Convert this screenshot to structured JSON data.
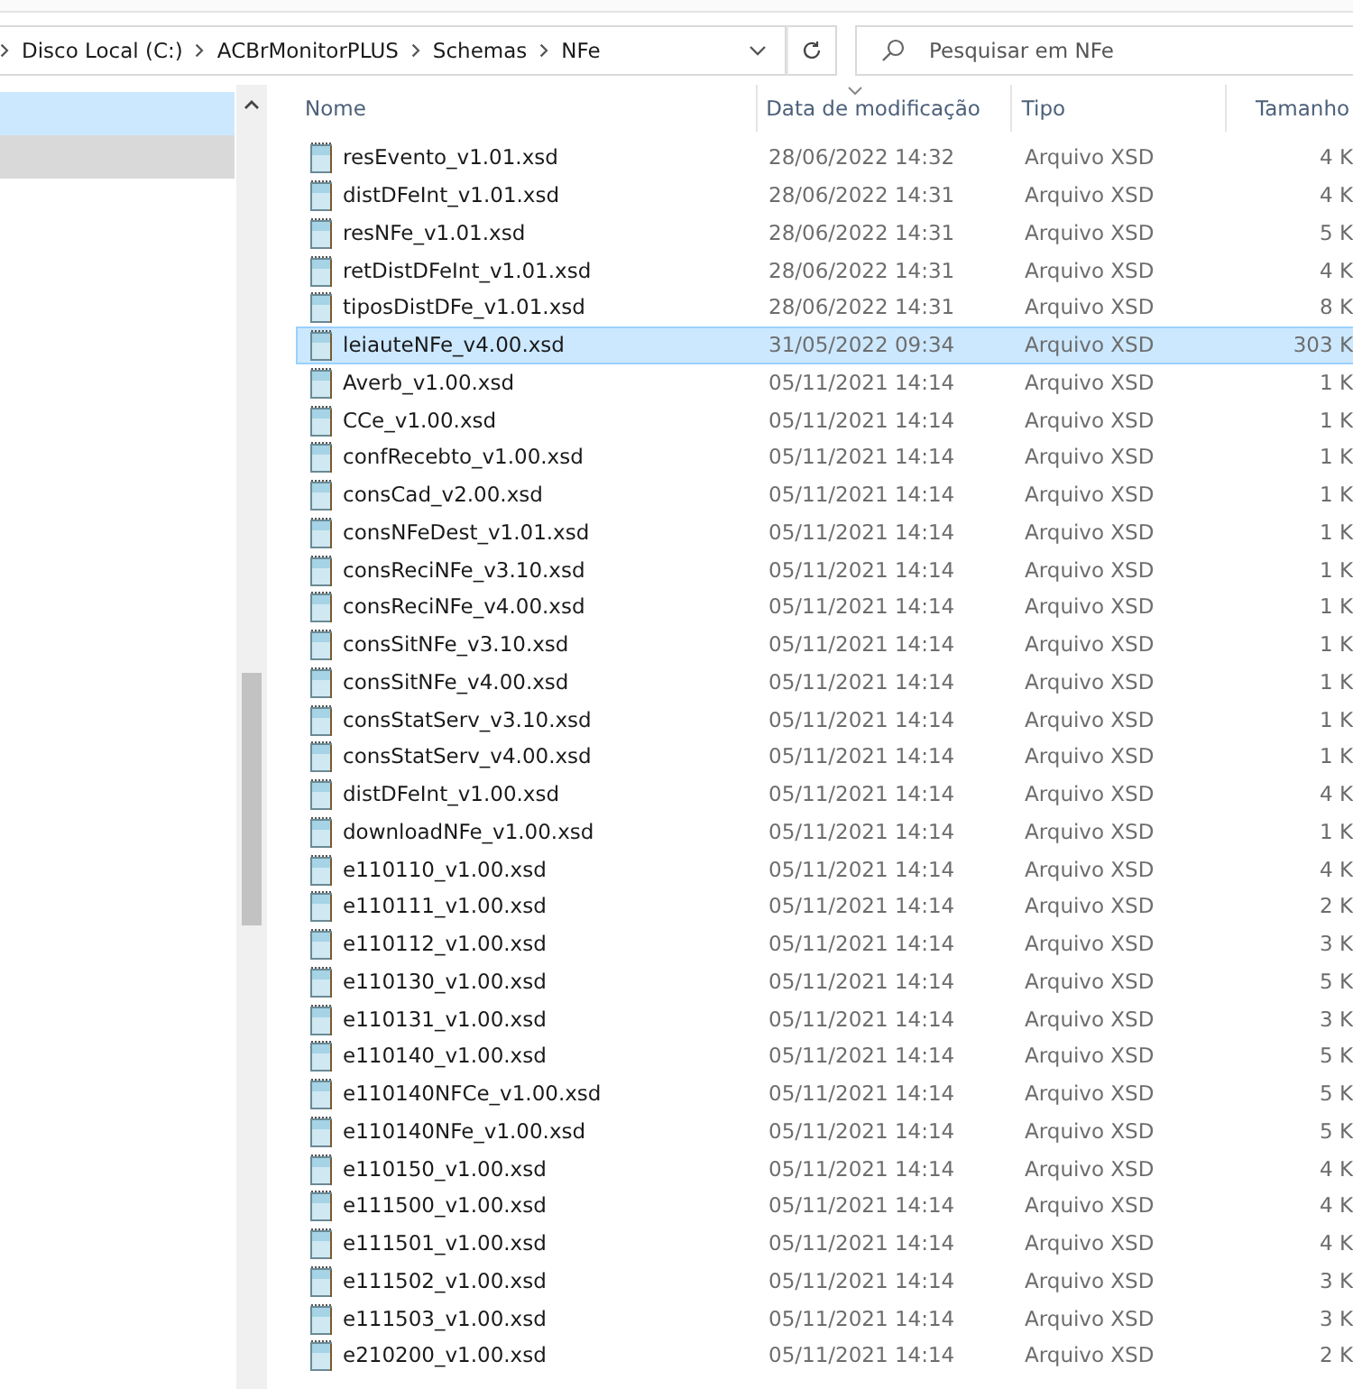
{
  "address_bar": {
    "breadcrumbs": [
      "Disco Local (C:)",
      "ACBrMonitorPLUS",
      "Schemas",
      "NFe"
    ]
  },
  "search": {
    "placeholder": "Pesquisar em NFe"
  },
  "navigation_pane": {
    "items": [
      {
        "selected": true
      },
      {
        "selected": false
      }
    ]
  },
  "file_list": {
    "columns": [
      "Nome",
      "Data de modificação",
      "Tipo",
      "Tamanho"
    ],
    "rows": [
      {
        "name": "resEvento_v1.01.xsd",
        "date": "28/06/2022 14:32",
        "type": "Arquivo XSD",
        "size": "4 K",
        "selected": false
      },
      {
        "name": "distDFeInt_v1.01.xsd",
        "date": "28/06/2022 14:31",
        "type": "Arquivo XSD",
        "size": "4 K",
        "selected": false
      },
      {
        "name": "resNFe_v1.01.xsd",
        "date": "28/06/2022 14:31",
        "type": "Arquivo XSD",
        "size": "5 K",
        "selected": false
      },
      {
        "name": "retDistDFeInt_v1.01.xsd",
        "date": "28/06/2022 14:31",
        "type": "Arquivo XSD",
        "size": "4 K",
        "selected": false
      },
      {
        "name": "tiposDistDFe_v1.01.xsd",
        "date": "28/06/2022 14:31",
        "type": "Arquivo XSD",
        "size": "8 K",
        "selected": false
      },
      {
        "name": "leiauteNFe_v4.00.xsd",
        "date": "31/05/2022 09:34",
        "type": "Arquivo XSD",
        "size": "303 K",
        "selected": true
      },
      {
        "name": "Averb_v1.00.xsd",
        "date": "05/11/2021 14:14",
        "type": "Arquivo XSD",
        "size": "1 K",
        "selected": false
      },
      {
        "name": "CCe_v1.00.xsd",
        "date": "05/11/2021 14:14",
        "type": "Arquivo XSD",
        "size": "1 K",
        "selected": false
      },
      {
        "name": "confRecebto_v1.00.xsd",
        "date": "05/11/2021 14:14",
        "type": "Arquivo XSD",
        "size": "1 K",
        "selected": false
      },
      {
        "name": "consCad_v2.00.xsd",
        "date": "05/11/2021 14:14",
        "type": "Arquivo XSD",
        "size": "1 K",
        "selected": false
      },
      {
        "name": "consNFeDest_v1.01.xsd",
        "date": "05/11/2021 14:14",
        "type": "Arquivo XSD",
        "size": "1 K",
        "selected": false
      },
      {
        "name": "consReciNFe_v3.10.xsd",
        "date": "05/11/2021 14:14",
        "type": "Arquivo XSD",
        "size": "1 K",
        "selected": false
      },
      {
        "name": "consReciNFe_v4.00.xsd",
        "date": "05/11/2021 14:14",
        "type": "Arquivo XSD",
        "size": "1 K",
        "selected": false
      },
      {
        "name": "consSitNFe_v3.10.xsd",
        "date": "05/11/2021 14:14",
        "type": "Arquivo XSD",
        "size": "1 K",
        "selected": false
      },
      {
        "name": "consSitNFe_v4.00.xsd",
        "date": "05/11/2021 14:14",
        "type": "Arquivo XSD",
        "size": "1 K",
        "selected": false
      },
      {
        "name": "consStatServ_v3.10.xsd",
        "date": "05/11/2021 14:14",
        "type": "Arquivo XSD",
        "size": "1 K",
        "selected": false
      },
      {
        "name": "consStatServ_v4.00.xsd",
        "date": "05/11/2021 14:14",
        "type": "Arquivo XSD",
        "size": "1 K",
        "selected": false
      },
      {
        "name": "distDFeInt_v1.00.xsd",
        "date": "05/11/2021 14:14",
        "type": "Arquivo XSD",
        "size": "4 K",
        "selected": false
      },
      {
        "name": "downloadNFe_v1.00.xsd",
        "date": "05/11/2021 14:14",
        "type": "Arquivo XSD",
        "size": "1 K",
        "selected": false
      },
      {
        "name": "e110110_v1.00.xsd",
        "date": "05/11/2021 14:14",
        "type": "Arquivo XSD",
        "size": "4 K",
        "selected": false
      },
      {
        "name": "e110111_v1.00.xsd",
        "date": "05/11/2021 14:14",
        "type": "Arquivo XSD",
        "size": "2 K",
        "selected": false
      },
      {
        "name": "e110112_v1.00.xsd",
        "date": "05/11/2021 14:14",
        "type": "Arquivo XSD",
        "size": "3 K",
        "selected": false
      },
      {
        "name": "e110130_v1.00.xsd",
        "date": "05/11/2021 14:14",
        "type": "Arquivo XSD",
        "size": "5 K",
        "selected": false
      },
      {
        "name": "e110131_v1.00.xsd",
        "date": "05/11/2021 14:14",
        "type": "Arquivo XSD",
        "size": "3 K",
        "selected": false
      },
      {
        "name": "e110140_v1.00.xsd",
        "date": "05/11/2021 14:14",
        "type": "Arquivo XSD",
        "size": "5 K",
        "selected": false
      },
      {
        "name": "e110140NFCe_v1.00.xsd",
        "date": "05/11/2021 14:14",
        "type": "Arquivo XSD",
        "size": "5 K",
        "selected": false
      },
      {
        "name": "e110140NFe_v1.00.xsd",
        "date": "05/11/2021 14:14",
        "type": "Arquivo XSD",
        "size": "5 K",
        "selected": false
      },
      {
        "name": "e110150_v1.00.xsd",
        "date": "05/11/2021 14:14",
        "type": "Arquivo XSD",
        "size": "4 K",
        "selected": false
      },
      {
        "name": "e111500_v1.00.xsd",
        "date": "05/11/2021 14:14",
        "type": "Arquivo XSD",
        "size": "4 K",
        "selected": false
      },
      {
        "name": "e111501_v1.00.xsd",
        "date": "05/11/2021 14:14",
        "type": "Arquivo XSD",
        "size": "4 K",
        "selected": false
      },
      {
        "name": "e111502_v1.00.xsd",
        "date": "05/11/2021 14:14",
        "type": "Arquivo XSD",
        "size": "3 K",
        "selected": false
      },
      {
        "name": "e111503_v1.00.xsd",
        "date": "05/11/2021 14:14",
        "type": "Arquivo XSD",
        "size": "3 K",
        "selected": false
      },
      {
        "name": "e210200_v1.00.xsd",
        "date": "05/11/2021 14:14",
        "type": "Arquivo XSD",
        "size": "2 K",
        "selected": false
      }
    ]
  }
}
